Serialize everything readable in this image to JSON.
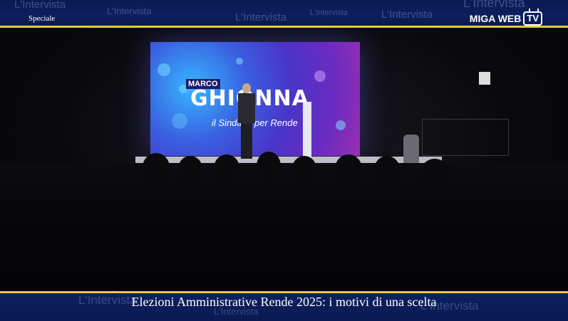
{
  "header": {
    "section_label": "Speciale",
    "brand_name": "MIGA WEB",
    "brand_tv": "TV",
    "watermark": "L'Intervista"
  },
  "scene": {
    "screen_first_name": "MARCO",
    "screen_last_name": "GHIONNA",
    "screen_subtitle": "il Sindaco per Rende"
  },
  "footer": {
    "headline": "Elezioni Amministrative Rende 2025: i motivi di una scelta"
  }
}
